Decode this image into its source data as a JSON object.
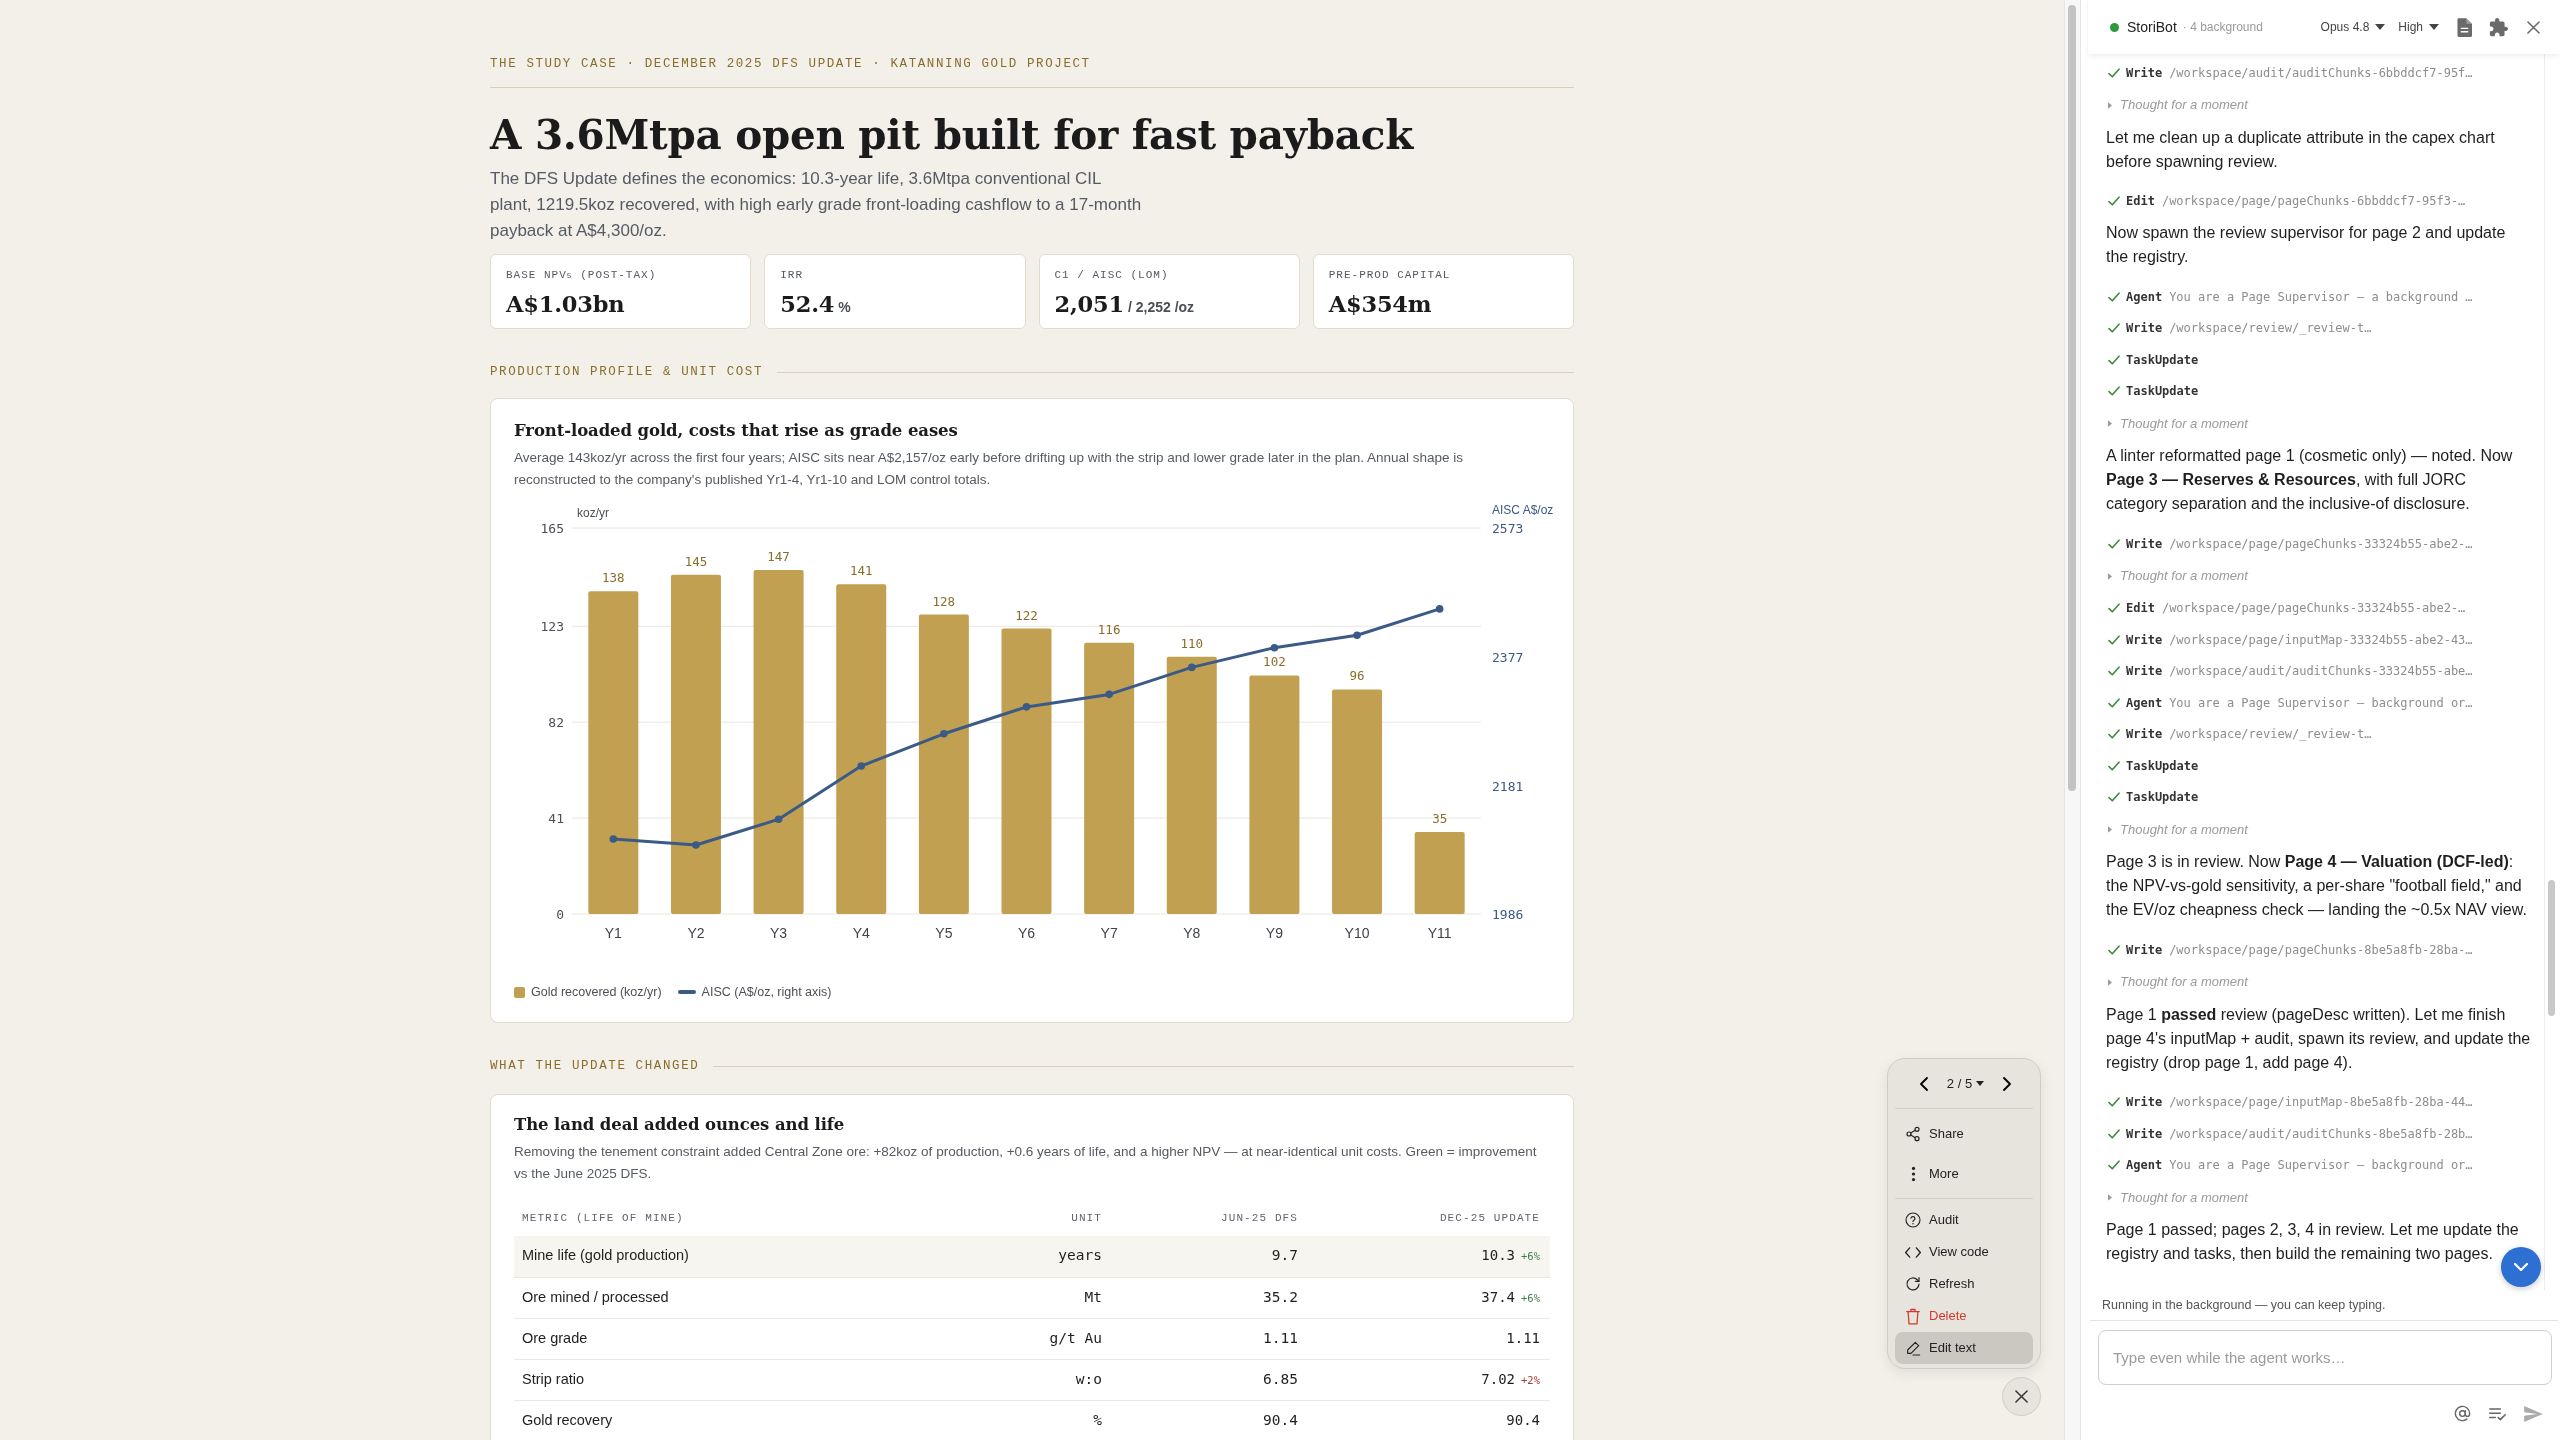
{
  "page": {
    "eyebrow": "THE STUDY CASE · DECEMBER 2025 DFS UPDATE · KATANNING GOLD PROJECT",
    "title": "A 3.6Mtpa open pit built for fast payback",
    "lead": "The DFS Update defines the economics: 10.3-year life, 3.6Mtpa conventional CIL plant, 1219.5koz recovered, with high early grade front-loading cashflow to a 17-month payback at A$4,300/oz.",
    "kpis": [
      {
        "label": "BASE NPV$_{5}$ (POST-TAX)",
        "value": "A$1.03bn"
      },
      {
        "label": "IRR",
        "value": "52.4",
        "unit": "%"
      },
      {
        "label": "C1 / AISC (LOM)",
        "value": "2,051",
        "unit": "/ 2,252 /oz"
      },
      {
        "label": "PRE-PROD CAPITAL",
        "value": "A$354m"
      }
    ]
  },
  "production": {
    "heading": "PRODUCTION PROFILE & UNIT COST",
    "title": "Front-loaded gold, costs that rise as grade eases",
    "description": "Average 143koz/yr across the first four years; AISC sits near A$2,157/oz early before drifting up with the strip and lower grade later in the plan. Annual shape is reconstructed to the company's published Yr1-4, Yr1-10 and LOM control totals.",
    "chart_data": {
      "type": "bar",
      "ylabel": "koz/yr",
      "y2label": "AISC A$/oz",
      "categories": [
        "Y1",
        "Y2",
        "Y3",
        "Y4",
        "Y5",
        "Y6",
        "Y7",
        "Y8",
        "Y9",
        "Y10",
        "Y11"
      ],
      "ylim": [
        0,
        165
      ],
      "yticks": [
        0,
        41,
        82,
        123,
        165
      ],
      "y2lim": [
        1986,
        2573
      ],
      "y2ticks": [
        1986,
        2181,
        2377,
        2573
      ],
      "grid": true,
      "series": [
        {
          "name": "Gold recovered (koz/yr)",
          "type": "bar",
          "color": "#c2a052",
          "values": [
            138,
            145,
            147,
            141,
            128,
            122,
            116,
            110,
            102,
            96,
            35
          ],
          "value_labels": [
            "138",
            "145",
            "147",
            "141",
            "128",
            "122",
            "116",
            "110",
            "102",
            "96",
            "35"
          ]
        },
        {
          "name": "AISC (A$/oz, right axis)",
          "type": "line",
          "axis": "y2",
          "marker": "circle",
          "color": "#3b5a85",
          "values": [
            2100,
            2091,
            2130,
            2211,
            2260,
            2301,
            2320,
            2361,
            2391,
            2410,
            2450
          ]
        }
      ]
    }
  },
  "changes": {
    "heading": "WHAT THE UPDATE CHANGED",
    "title": "The land deal added ounces and life",
    "description": "Removing the tenement constraint added Central Zone ore: +82koz of production, +0.6 years of life, and a higher NPV — at near-identical unit costs. Green = improvement vs the June 2025 DFS.",
    "table": {
      "columns": [
        "METRIC (LIFE OF MINE)",
        "UNIT",
        "JUN-25 DFS",
        "DEC-25 UPDATE"
      ],
      "rows": [
        {
          "metric": "Mine life (gold production)",
          "unit": "years",
          "before": "9.7",
          "after": "10.3",
          "change": {
            "text": "+6%",
            "improvement": true
          },
          "highlighted": true
        },
        {
          "metric": "Ore mined / processed",
          "unit": "Mt",
          "before": "35.2",
          "after": "37.4",
          "change": {
            "text": "+6%",
            "improvement": true
          },
          "highlighted": false
        },
        {
          "metric": "Ore grade",
          "unit": "g/t Au",
          "before": "1.11",
          "after": "1.11",
          "highlighted": false
        },
        {
          "metric": "Strip ratio",
          "unit": "w:o",
          "before": "6.85",
          "after": "7.02",
          "change": {
            "text": "+2%",
            "improvement": false
          },
          "highlighted": false
        },
        {
          "metric": "Gold recovery",
          "unit": "%",
          "before": "90.4",
          "after": "90.4",
          "highlighted": false
        }
      ]
    }
  },
  "assistant": {
    "title": "StoriBot",
    "online": true,
    "background_note": "· 4 background",
    "model": "Opus 4.8",
    "effort": "High",
    "log": [
      {
        "kind": "tool",
        "tool": "Write",
        "detail": "/workspace/audit/auditChunks-6bbddcf7-95f…",
        "done": true
      },
      {
        "kind": "thought",
        "text": "Thought for a moment",
        "expanded": false
      },
      {
        "kind": "message",
        "text": "Let me clean up a duplicate attribute in the capex chart before spawning review."
      },
      {
        "kind": "tool",
        "tool": "Edit",
        "detail": "/workspace/page/pageChunks-6bbddcf7-95f3-…",
        "done": true
      },
      {
        "kind": "message",
        "text": "Now spawn the review supervisor for page 2 and update the registry."
      },
      {
        "kind": "tool",
        "tool": "Agent",
        "detail": "You are a Page Supervisor — a background …",
        "done": true
      },
      {
        "kind": "tool",
        "tool": "Write",
        "detail": "/workspace/review/_review-t…",
        "done": true
      },
      {
        "kind": "tool",
        "tool": "TaskUpdate",
        "done": true
      },
      {
        "kind": "tool",
        "tool": "TaskUpdate",
        "done": true
      },
      {
        "kind": "thought",
        "text": "Thought for a moment",
        "expanded": false
      },
      {
        "kind": "message",
        "text": "A linter reformatted page 1 (cosmetic only) — noted. Now **Page 3 — Reserves & Resources**, with full JORC category separation and the inclusive-of disclosure."
      },
      {
        "kind": "tool",
        "tool": "Write",
        "detail": "/workspace/page/pageChunks-33324b55-abe2-…",
        "done": true
      },
      {
        "kind": "thought",
        "text": "Thought for a moment",
        "expanded": false
      },
      {
        "kind": "tool",
        "tool": "Edit",
        "detail": "/workspace/page/pageChunks-33324b55-abe2-…",
        "done": true
      },
      {
        "kind": "tool",
        "tool": "Write",
        "detail": "/workspace/page/inputMap-33324b55-abe2-43…",
        "done": true
      },
      {
        "kind": "tool",
        "tool": "Write",
        "detail": "/workspace/audit/auditChunks-33324b55-abe…",
        "done": true
      },
      {
        "kind": "tool",
        "tool": "Agent",
        "detail": "You are a Page Supervisor — background or…",
        "done": true
      },
      {
        "kind": "tool",
        "tool": "Write",
        "detail": "/workspace/review/_review-t…",
        "done": true
      },
      {
        "kind": "tool",
        "tool": "TaskUpdate",
        "done": true
      },
      {
        "kind": "tool",
        "tool": "TaskUpdate",
        "done": true
      },
      {
        "kind": "thought",
        "text": "Thought for a moment",
        "expanded": false
      },
      {
        "kind": "message",
        "text": "Page 3 is in review. Now **Page 4 — Valuation (DCF-led)**: the NPV-vs-gold sensitivity, a per-share \"football field,\" and the EV/oz cheapness check — landing the ~0.5x NAV view."
      },
      {
        "kind": "tool",
        "tool": "Write",
        "detail": "/workspace/page/pageChunks-8be5a8fb-28ba-…",
        "done": true
      },
      {
        "kind": "thought",
        "text": "Thought for a moment",
        "expanded": false
      },
      {
        "kind": "message",
        "text": "Page 1 **passed** review (pageDesc written). Let me finish page 4's inputMap + audit, spawn its review, and update the registry (drop page 1, add page 4)."
      },
      {
        "kind": "tool",
        "tool": "Write",
        "detail": "/workspace/page/inputMap-8be5a8fb-28ba-44…",
        "done": true
      },
      {
        "kind": "tool",
        "tool": "Write",
        "detail": "/workspace/audit/auditChunks-8be5a8fb-28b…",
        "done": true
      },
      {
        "kind": "tool",
        "tool": "Agent",
        "detail": "You are a Page Supervisor — background or…",
        "done": true
      },
      {
        "kind": "thought",
        "text": "Thought for a moment",
        "expanded": false
      },
      {
        "kind": "message",
        "text": "Page 1 passed; pages 2, 3, 4 in review. Let me update the registry and tasks, then build the remaining two pages."
      }
    ],
    "status_note": "Running in the background — you can keep typing.",
    "input": {
      "placeholder": "Type even while the agent works…"
    }
  },
  "action_menu": {
    "pager": "2 / 5",
    "groups": [
      [
        {
          "label": "Share",
          "kind": "default",
          "selected": false
        },
        {
          "label": "More",
          "kind": "default",
          "selected": false
        }
      ],
      [
        {
          "label": "Audit",
          "kind": "default",
          "selected": false
        },
        {
          "label": "View code",
          "kind": "default",
          "selected": false
        },
        {
          "label": "Refresh",
          "kind": "default",
          "selected": false
        },
        {
          "label": "Delete",
          "kind": "danger",
          "selected": false
        },
        {
          "label": "Edit text",
          "kind": "default",
          "selected": true
        }
      ]
    ]
  }
}
